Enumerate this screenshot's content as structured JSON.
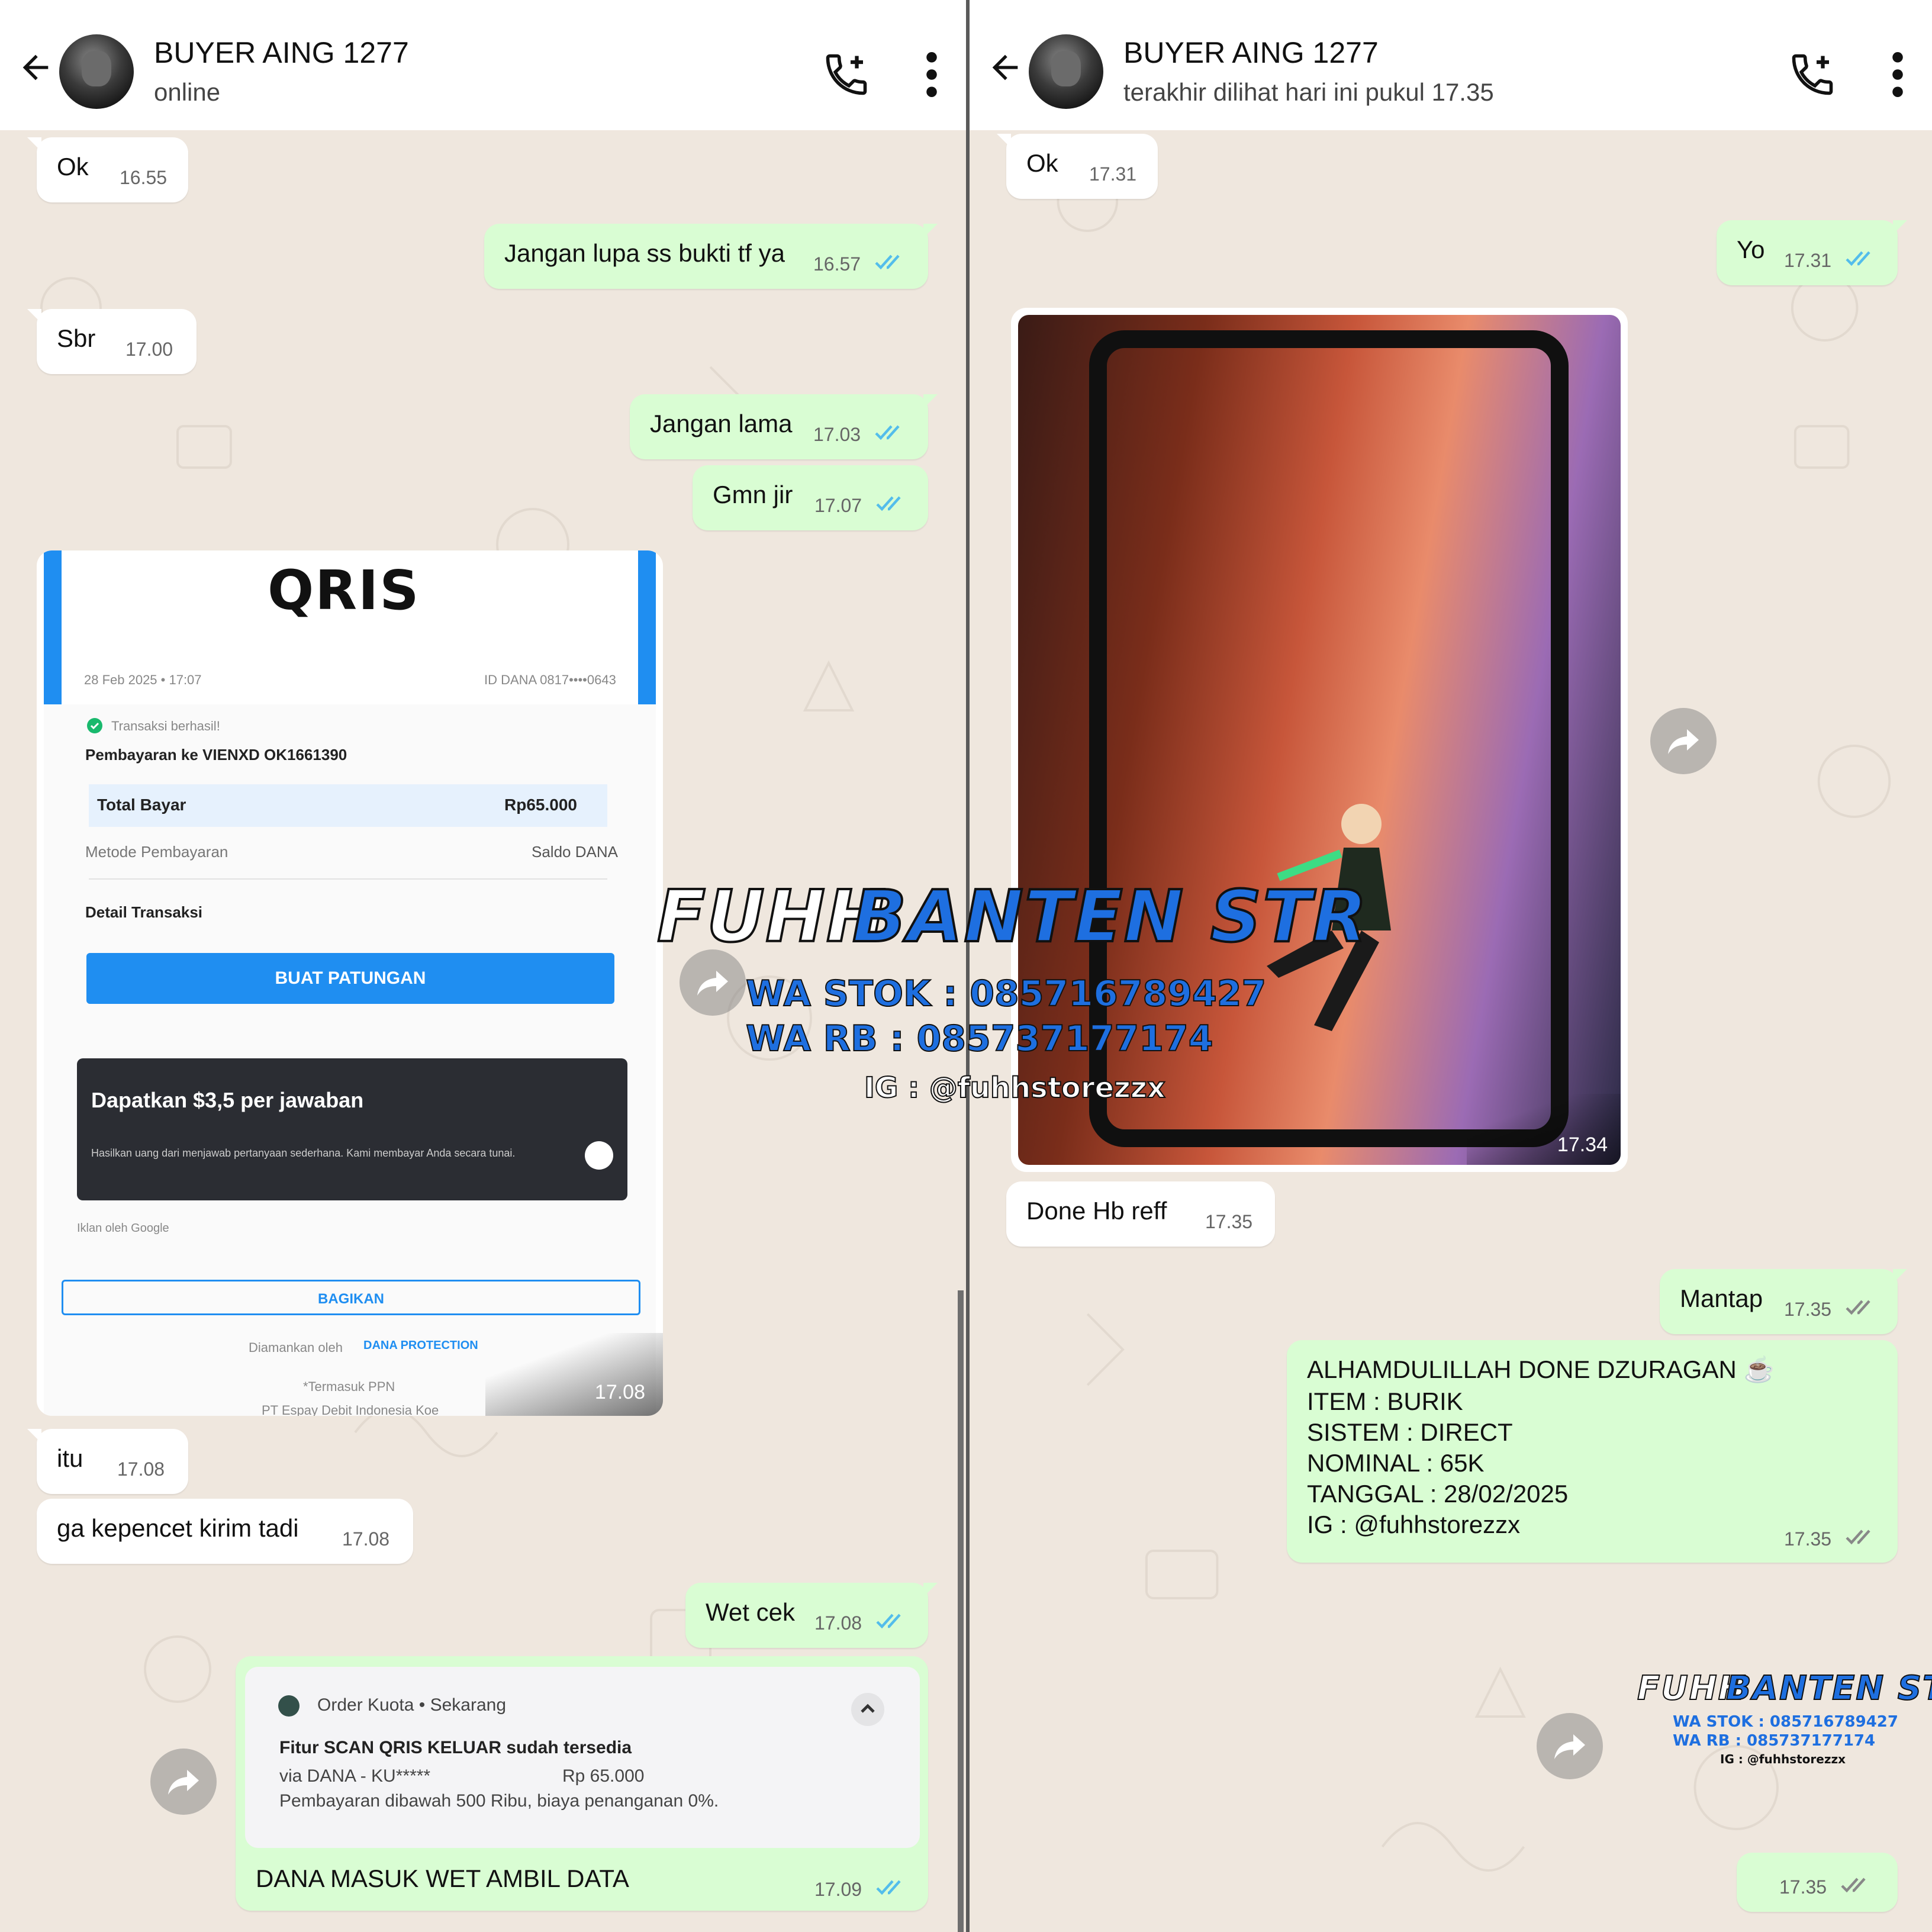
{
  "left": {
    "header": {
      "name": "BUYER AING 1277",
      "status": "online"
    },
    "messages": [
      {
        "text": "Ok",
        "time": "16.55"
      },
      {
        "text": "Jangan lupa ss bukti tf ya",
        "time": "16.57"
      },
      {
        "text": "Sbr",
        "time": "17.00"
      },
      {
        "text": "Jangan lama",
        "time": "17.03"
      },
      {
        "text": "Gmn jir",
        "time": "17.07"
      },
      {
        "text": "itu",
        "time": "17.08"
      },
      {
        "text": "ga kepencet kirim tadi",
        "time": "17.08"
      },
      {
        "text": "Wet cek",
        "time": "17.08"
      },
      {
        "text": "DANA MASUK WET AMBIL DATA",
        "time": "17.09"
      }
    ],
    "receipt": {
      "logo": "QRIS",
      "date": "28 Feb 2025 • 17:07",
      "dana_id": "ID DANA 0817••••0643",
      "success": "Transaksi berhasil!",
      "payment_to": "Pembayaran ke VIENXD OK1661390",
      "total_label": "Total Bayar",
      "total_value": "Rp65.000",
      "method_label": "Metode Pembayaran",
      "method_value": "Saldo DANA",
      "detail_label": "Detail Transaksi",
      "patungan_button": "BUAT PATUNGAN",
      "ad_title": "Dapatkan $3,5 per jawaban",
      "ad_sub": "Hasilkan uang dari menjawab pertanyaan sederhana. Kami membayar Anda secara tunai.",
      "ad_by": "Iklan oleh Google",
      "share_button": "BAGIKAN",
      "secured_by": "Diamankan oleh",
      "dana_protection": "DANA PROTECTION",
      "tax_note": "*Termasuk PPN",
      "company": "PT Espay Debit Indonesia Koe",
      "time": "17.08"
    },
    "notification": {
      "app": "Order Kuota • Sekarang",
      "title": "Fitur SCAN QRIS KELUAR sudah tersedia",
      "via": "via DANA - KU*****",
      "amount": "Rp 65.000",
      "fee": "Pembayaran dibawah 500 Ribu, biaya penanganan 0%."
    }
  },
  "right": {
    "header": {
      "name": "BUYER AING 1277",
      "status": "terakhir dilihat hari ini pukul 17.35"
    },
    "messages": [
      {
        "text": "Ok",
        "time": "17.31"
      },
      {
        "text": "Yo",
        "time": "17.31"
      },
      {
        "text": "Done Hb reff",
        "time": "17.35"
      },
      {
        "text": "Mantap",
        "time": "17.35"
      },
      {
        "text": "",
        "time": "17.35"
      }
    ],
    "photo_time": "17.34",
    "summary": {
      "lines": [
        "ALHAMDULILLAH DONE DZURAGAN ☕",
        "ITEM : BURIK",
        "SISTEM : DIRECT",
        "NOMINAL : 65K",
        "TANGGAL : 28/02/2025",
        "IG : @fuhhstorezzx"
      ],
      "time": "17.35"
    }
  },
  "watermark": {
    "title_a": "FUHH",
    "title_b": "BANTEN STR",
    "wa_stok": "WA STOK : 085716789427",
    "wa_rb": "WA RB :  085737177174",
    "ig": "IG : @fuhhstorezzx"
  },
  "colors": {
    "outgoing": "#d9fdd3",
    "incoming": "#ffffff",
    "tick_read": "#53bdeb",
    "dana_blue": "#1f8ef1",
    "watermark_blue": "#1e6fe0"
  },
  "icons": [
    "back-arrow-icon",
    "add-call-icon",
    "more-vert-icon",
    "double-check-icon",
    "forward-icon"
  ]
}
